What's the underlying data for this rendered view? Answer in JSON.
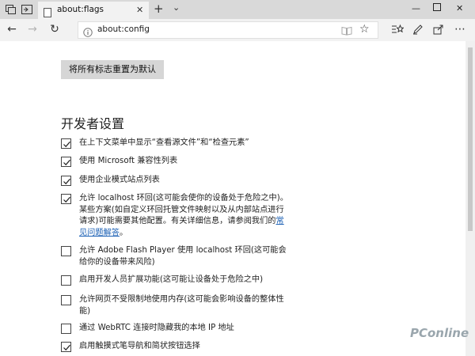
{
  "tab": {
    "title": "about:flags"
  },
  "address_bar": {
    "url": "about:config"
  },
  "content": {
    "reset_button": "将所有标志重置为默认",
    "section_title": "开发者设置",
    "options": [
      {
        "label": "在上下文菜单中显示“查看源文件”和“检查元素”",
        "checked": true
      },
      {
        "label": "使用 Microsoft 兼容性列表",
        "checked": true
      },
      {
        "label": "使用企业模式站点列表",
        "checked": true
      },
      {
        "label_before_link": "允许 localhost 环回(这可能会使你的设备处于危险之中)。某些方案(如自定义环回托管文件映射以及从内部站点进行请求)可能需要其他配置。有关详细信息，请参阅我们的",
        "link": "常见问题解答",
        "label_after_link": "。",
        "checked": true
      },
      {
        "label": "允许 Adobe Flash Player 使用 localhost 环回(这可能会给你的设备带来风险)",
        "checked": false
      },
      {
        "label": "启用开发人员扩展功能(这可能让设备处于危险之中)",
        "checked": false
      },
      {
        "label": "允许网页不受限制地使用内存(这可能会影响设备的整体性能)",
        "checked": false
      },
      {
        "label": "通过 WebRTC 连接时隐藏我的本地 IP 地址",
        "checked": false
      },
      {
        "label": "启用触摸式笔导航和简状按钮选择",
        "checked": true
      }
    ]
  },
  "watermark": "PConline",
  "icons": {
    "tab_switcher": "tab-switcher-icon",
    "set_aside": "set-aside-tabs-icon",
    "favicon": "page-icon",
    "close": "close-icon",
    "new_tab": "plus-icon",
    "tab_list": "chevron-down-icon",
    "back": "back-arrow-icon",
    "forward": "forward-arrow-icon",
    "refresh": "refresh-icon",
    "info": "info-icon",
    "reading_view": "reading-view-icon",
    "favorite": "star-icon",
    "favorites_bar": "favorites-icon",
    "notes": "pen-icon",
    "share": "share-icon",
    "more": "more-icon"
  }
}
